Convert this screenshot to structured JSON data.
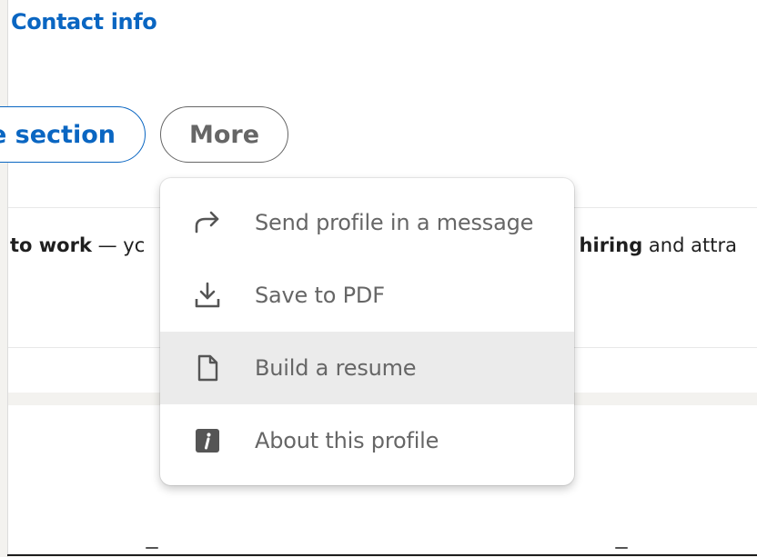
{
  "header": {
    "contact_link": "Contact info"
  },
  "actions": {
    "section_label": "e section",
    "more_label": "More"
  },
  "banner": {
    "left_bold": "to work",
    "left_rest": " — yc",
    "right_bold": "e hiring",
    "right_rest": " and attra"
  },
  "menu": {
    "items": [
      {
        "label": "Send profile in a message",
        "icon": "share-arrow-icon"
      },
      {
        "label": "Save to PDF",
        "icon": "download-icon"
      },
      {
        "label": "Build a resume",
        "icon": "document-icon"
      },
      {
        "label": "About this profile",
        "icon": "info-icon"
      }
    ],
    "hovered_index": 2
  },
  "colors": {
    "link": "#0a66c2",
    "muted": "#666666",
    "menu_hover": "#ebebeb",
    "page_bg": "#f3f2ef"
  }
}
